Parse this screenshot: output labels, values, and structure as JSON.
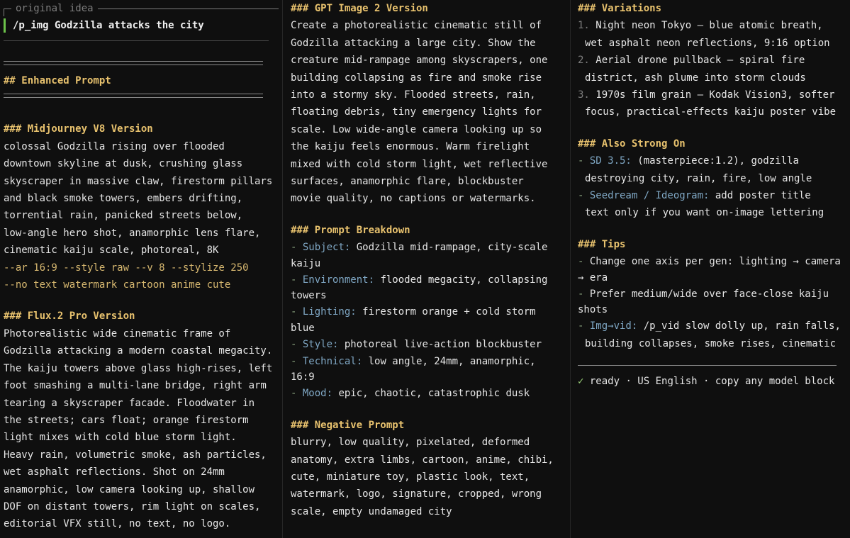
{
  "col1": {
    "idea_label": "original idea",
    "idea_text": "/p_img Godzilla attacks the city",
    "enhanced_heading": "## Enhanced Prompt",
    "mj_heading": "### Midjourney V8 Version",
    "mj_lines": [
      "colossal Godzilla rising over flooded",
      "downtown skyline at dusk, crushing glass",
      "skyscraper in massive claw, firestorm pillars",
      "and black smoke towers, embers drifting,",
      "torrential rain, panicked streets below,",
      "low-angle hero shot, anamorphic lens flare,",
      "cinematic kaiju scale, photoreal, 8K"
    ],
    "mj_params": [
      "--ar 16:9 --style raw --v 8 --stylize 250",
      "--no text watermark cartoon anime cute"
    ],
    "flux_heading": "### Flux.2 Pro Version",
    "flux_lines": [
      "Photorealistic wide cinematic frame of",
      "Godzilla attacking a modern coastal megacity.",
      "The kaiju towers above glass high-rises, left",
      "foot smashing a multi-lane bridge, right arm",
      "tearing a skyscraper facade. Floodwater in",
      "the streets; cars float; orange firestorm",
      "light mixes with cold blue storm light.",
      "Heavy rain, volumetric smoke, ash particles,",
      "wet asphalt reflections. Shot on 24mm",
      "anamorphic, low camera looking up, shallow",
      "DOF on distant towers, rim light on scales,",
      "editorial VFX still, no text, no logo."
    ]
  },
  "col2": {
    "gpt_heading": "### GPT Image 2 Version",
    "gpt_lines": [
      "Create a photorealistic cinematic still of",
      "Godzilla attacking a large city. Show the",
      "creature mid-rampage among skyscrapers, one",
      "building collapsing as fire and smoke rise",
      "into a stormy sky. Flooded streets, rain,",
      "floating debris, tiny emergency lights for",
      "scale. Low wide-angle camera looking up so",
      "the kaiju feels enormous. Warm firelight",
      "mixed with cold storm light, wet reflective",
      "surfaces, anamorphic flare, blockbuster",
      "movie quality, no captions or watermarks."
    ],
    "breakdown_heading": "### Prompt Breakdown",
    "breakdown": [
      {
        "key": "Subject:",
        "l1": " Godzilla mid-rampage, city-scale",
        "l2": "kaiju"
      },
      {
        "key": "Environment:",
        "l1": " flooded megacity, collapsing",
        "l2": "towers"
      },
      {
        "key": "Lighting:",
        "l1": " firestorm orange + cold storm",
        "l2": "blue"
      },
      {
        "key": "Style:",
        "l1": " photoreal live-action blockbuster",
        "l2": ""
      },
      {
        "key": "Technical:",
        "l1": " low angle, 24mm, anamorphic,",
        "l2": "16:9"
      },
      {
        "key": "Mood:",
        "l1": " epic, chaotic, catastrophic dusk",
        "l2": ""
      }
    ],
    "negative_heading": "### Negative Prompt",
    "negative_lines": [
      "blurry, low quality, pixelated, deformed",
      "anatomy, extra limbs, cartoon, anime, chibi,",
      "cute, miniature toy, plastic look, text,",
      "watermark, logo, signature, cropped, wrong",
      "scale, empty undamaged city"
    ]
  },
  "col3": {
    "variations_heading": "### Variations",
    "variations": [
      {
        "num": "1.",
        "l1": " Night neon Tokyo — blue atomic breath,",
        "l2": "wet asphalt neon reflections, 9:16 option"
      },
      {
        "num": "2.",
        "l1": " Aerial drone pullback — spiral fire",
        "l2": "district, ash plume into storm clouds"
      },
      {
        "num": "3.",
        "l1": " 1970s film grain — Kodak Vision3, softer",
        "l2": "focus, practical-effects kaiju poster vibe"
      }
    ],
    "also_heading": "### Also Strong On",
    "also": [
      {
        "key": "SD 3.5:",
        "l1": " (masterpiece:1.2), godzilla",
        "l2": "destroying city, rain, fire, low angle"
      },
      {
        "key": "Seedream / Ideogram:",
        "l1": " add poster title",
        "l2": "text only if you want on-image lettering"
      }
    ],
    "tips_heading": "### Tips",
    "tips": [
      {
        "key": "",
        "l1": "Change one axis per gen: lighting → camera",
        "l2": "→ era"
      },
      {
        "key": "",
        "l1": "Prefer medium/wide over face-close kaiju",
        "l2": "shots"
      },
      {
        "key": "Img→vid:",
        "l1": " /p_vid slow dolly up, rain falls,",
        "l2": "building collapses, smoke rises, cinematic"
      }
    ],
    "status_check": "✓",
    "status_text": " ready · US English · copy any model block"
  },
  "colors": {
    "heading": "#e8c26e",
    "accent": "#7fa7c4",
    "param": "#d7b870",
    "ok": "#9bd17a"
  }
}
